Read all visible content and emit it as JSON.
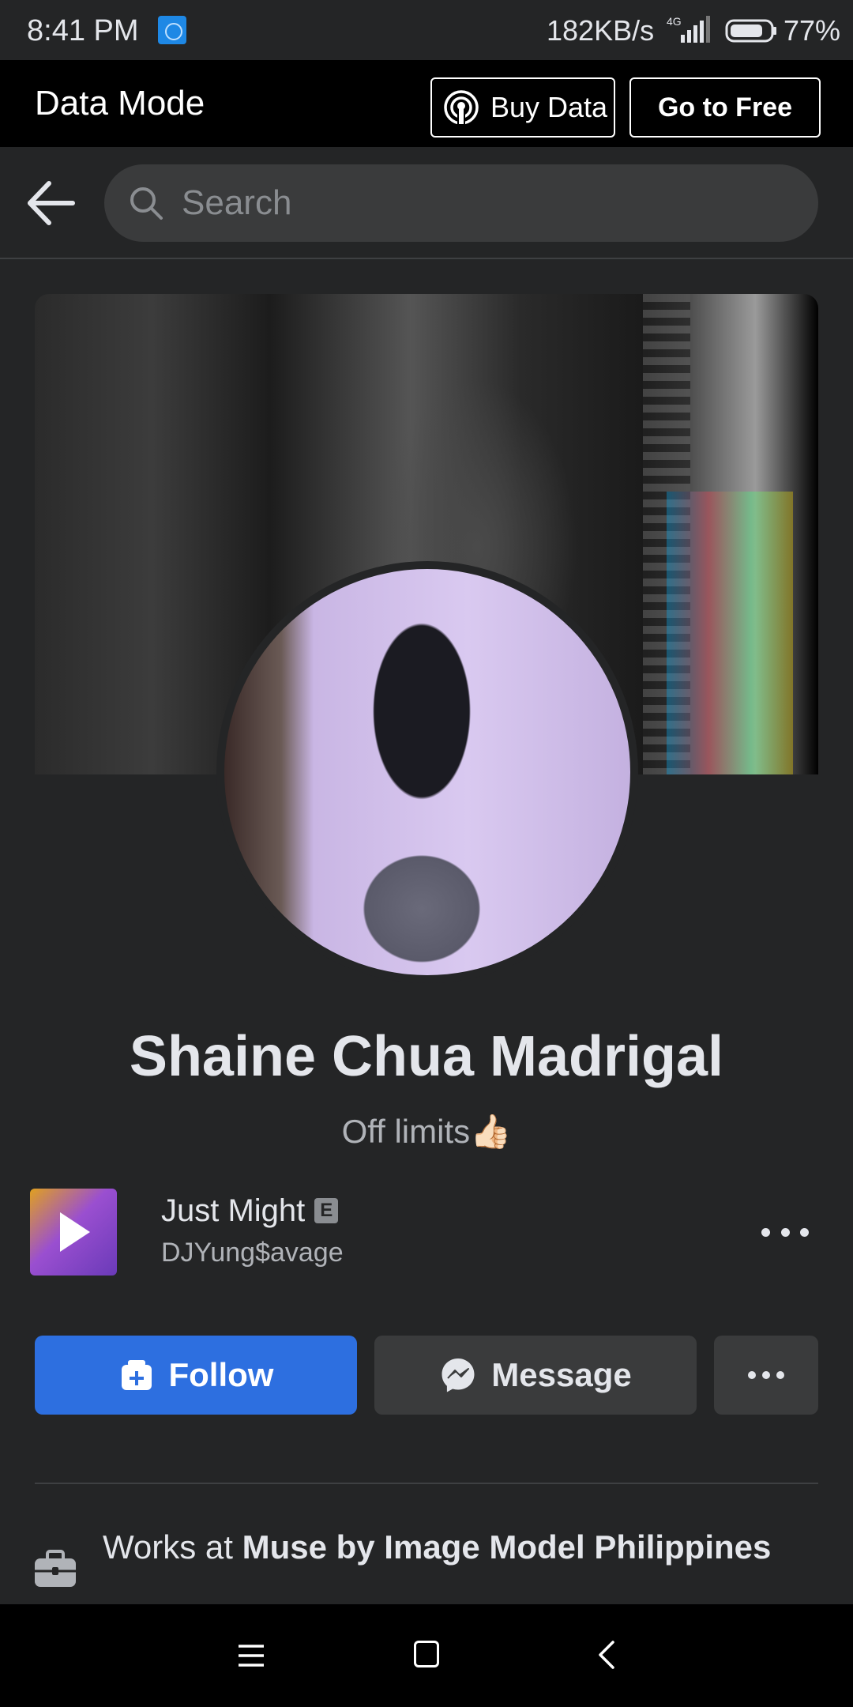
{
  "status_bar": {
    "time": "8:41  PM",
    "net_speed": "182KB/s",
    "network": "4G",
    "battery": "77%"
  },
  "data_mode": {
    "title": "Data Mode",
    "buy_data_label": "Buy Data",
    "go_free_label": "Go to Free"
  },
  "search": {
    "placeholder": "Search"
  },
  "profile": {
    "name": "Shaine Chua Madrigal",
    "bio": "Off limits👍🏻"
  },
  "music": {
    "song": "Just Might",
    "explicit_badge": "E",
    "artist": "DJYung$avage"
  },
  "actions": {
    "follow_label": "Follow",
    "message_label": "Message"
  },
  "work": {
    "prefix": "Works at ",
    "company": "Muse by Image Model Philippines"
  },
  "colors": {
    "background": "#242526",
    "follow_button": "#2d6fe0",
    "secondary_button": "#3a3b3c",
    "data_bar": "#000000"
  }
}
